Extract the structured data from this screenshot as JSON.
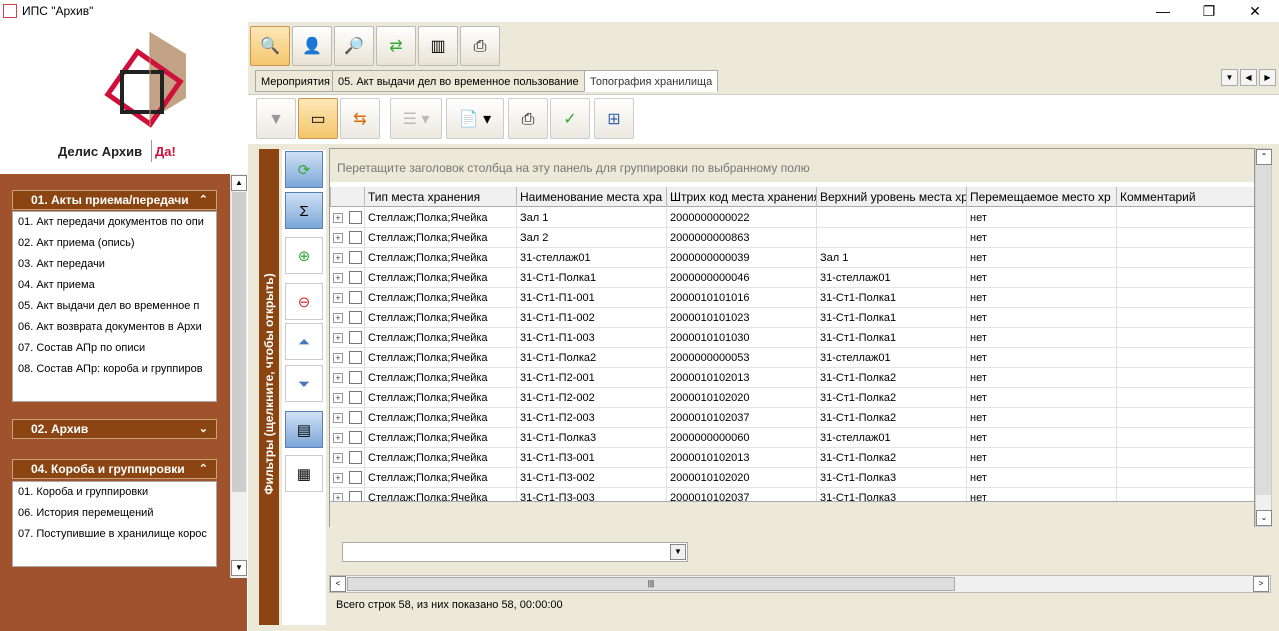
{
  "window": {
    "title": "ИПС \"Архив\"",
    "minimize": "—",
    "restore": "❐",
    "close": "✕"
  },
  "logo": {
    "name": "Делис Архив",
    "accent": "Да!"
  },
  "sidebar": {
    "groups": [
      {
        "title": "01. Акты приема/передачи",
        "items": [
          "01. Акт передачи документов по опи",
          "02. Акт приема (опись)",
          "03. Акт передачи",
          "04. Акт приема",
          "05. Акт выдачи дел во временное п",
          "06. Акт возврата документов в Архи",
          "07. Состав АПр по описи",
          "08. Состав АПр: короба и группиров"
        ]
      },
      {
        "title": "02. Архив",
        "items": []
      },
      {
        "title": "04. Короба и группировки",
        "items": [
          "01. Короба и группировки",
          "06. История перемещений",
          "07. Поступившие в хранилище корос"
        ]
      }
    ]
  },
  "tabs": [
    "Мероприятия",
    "05. Акт выдачи дел во временное пользование",
    "Топография хранилища"
  ],
  "filters_label": "Фильтры (щелкните, чтобы открыть)",
  "grid": {
    "group_panel_hint": "Перетащите заголовок столбца на эту панель для группировки по выбранному полю",
    "columns": [
      "Тип места хранения",
      "Наименование места хра",
      "Штрих код места хранения",
      "Верхний уровень места хр",
      "Перемещаемое место хр",
      "Комментарий"
    ],
    "rows": [
      [
        "Стеллаж;Полка;Ячейка",
        "Зал 1",
        "2000000000022",
        "",
        "нет",
        ""
      ],
      [
        "Стеллаж;Полка;Ячейка",
        "Зал 2",
        "2000000000863",
        "",
        "нет",
        ""
      ],
      [
        "Стеллаж;Полка;Ячейка",
        "31-стеллаж01",
        "2000000000039",
        "Зал 1",
        "нет",
        ""
      ],
      [
        "Стеллаж;Полка;Ячейка",
        "31-Ст1-Полка1",
        "2000000000046",
        "31-стеллаж01",
        "нет",
        ""
      ],
      [
        "Стеллаж;Полка;Ячейка",
        "31-Ст1-П1-001",
        "2000010101016",
        "31-Ст1-Полка1",
        "нет",
        ""
      ],
      [
        "Стеллаж;Полка;Ячейка",
        "31-Ст1-П1-002",
        "2000010101023",
        "31-Ст1-Полка1",
        "нет",
        ""
      ],
      [
        "Стеллаж;Полка;Ячейка",
        "31-Ст1-П1-003",
        "2000010101030",
        "31-Ст1-Полка1",
        "нет",
        ""
      ],
      [
        "Стеллаж;Полка;Ячейка",
        "31-Ст1-Полка2",
        "2000000000053",
        "31-стеллаж01",
        "нет",
        ""
      ],
      [
        "Стеллаж;Полка;Ячейка",
        "31-Ст1-П2-001",
        "2000010102013",
        "31-Ст1-Полка2",
        "нет",
        ""
      ],
      [
        "Стеллаж;Полка;Ячейка",
        "31-Ст1-П2-002",
        "2000010102020",
        "31-Ст1-Полка2",
        "нет",
        ""
      ],
      [
        "Стеллаж;Полка;Ячейка",
        "31-Ст1-П2-003",
        "2000010102037",
        "31-Ст1-Полка2",
        "нет",
        ""
      ],
      [
        "Стеллаж;Полка;Ячейка",
        "31-Ст1-Полка3",
        "2000000000060",
        "31-стеллаж01",
        "нет",
        ""
      ],
      [
        "Стеллаж;Полка;Ячейка",
        "31-Ст1-П3-001",
        "2000010102013",
        "31-Ст1-Полка2",
        "нет",
        ""
      ],
      [
        "Стеллаж;Полка;Ячейка",
        "31-Ст1-П3-002",
        "2000010102020",
        "31-Ст1-Полка3",
        "нет",
        ""
      ],
      [
        "Стеллаж;Полка;Ячейка",
        "31-Ст1-П3-003",
        "2000010102037",
        "31-Ст1-Полка3",
        "нет",
        ""
      ]
    ]
  },
  "status": "Всего строк 58, из них показано 58, 00:00:00"
}
